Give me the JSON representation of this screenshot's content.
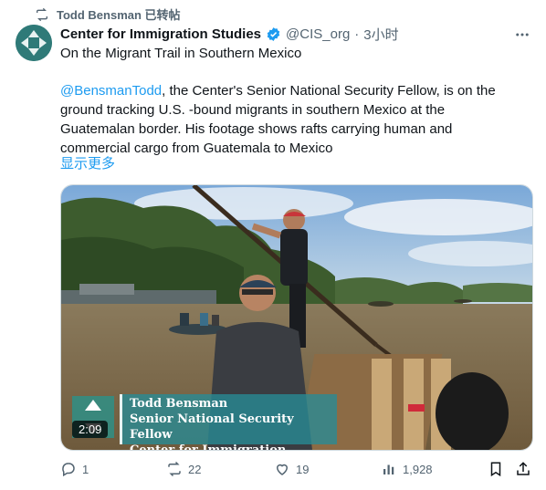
{
  "repost": {
    "label": "Todd Bensman 已转帖"
  },
  "tweet": {
    "author_name": "Center for Immigration Studies",
    "handle": "@CIS_org",
    "separator": "·",
    "time": "3小时",
    "title": "On the Migrant Trail in Southern Mexico",
    "mention": "@BensmanTodd",
    "body": ", the Center's Senior National Security Fellow, is on the ground tracking U.S. -bound migrants in southern Mexico at the Guatemalan border. His footage shows rafts carrying human and commercial cargo from Guatemala to Mexico",
    "show_more": "显示更多"
  },
  "video": {
    "duration": "2:09",
    "lower_third": {
      "line1": "Todd Bensman",
      "line2": "Senior National Security Fellow",
      "line3": "Center for Immigration Studies"
    }
  },
  "actions": {
    "replies": "1",
    "reposts": "22",
    "likes": "19",
    "views": "1,928"
  },
  "colors": {
    "accent": "#1d9bf0",
    "secondary_text": "#536471",
    "brand_teal": "#2f7a78"
  },
  "icons": [
    "repost-icon",
    "verified-icon",
    "more-icon",
    "reply-icon",
    "retweet-icon",
    "like-icon",
    "views-icon",
    "bookmark-icon",
    "share-icon"
  ]
}
